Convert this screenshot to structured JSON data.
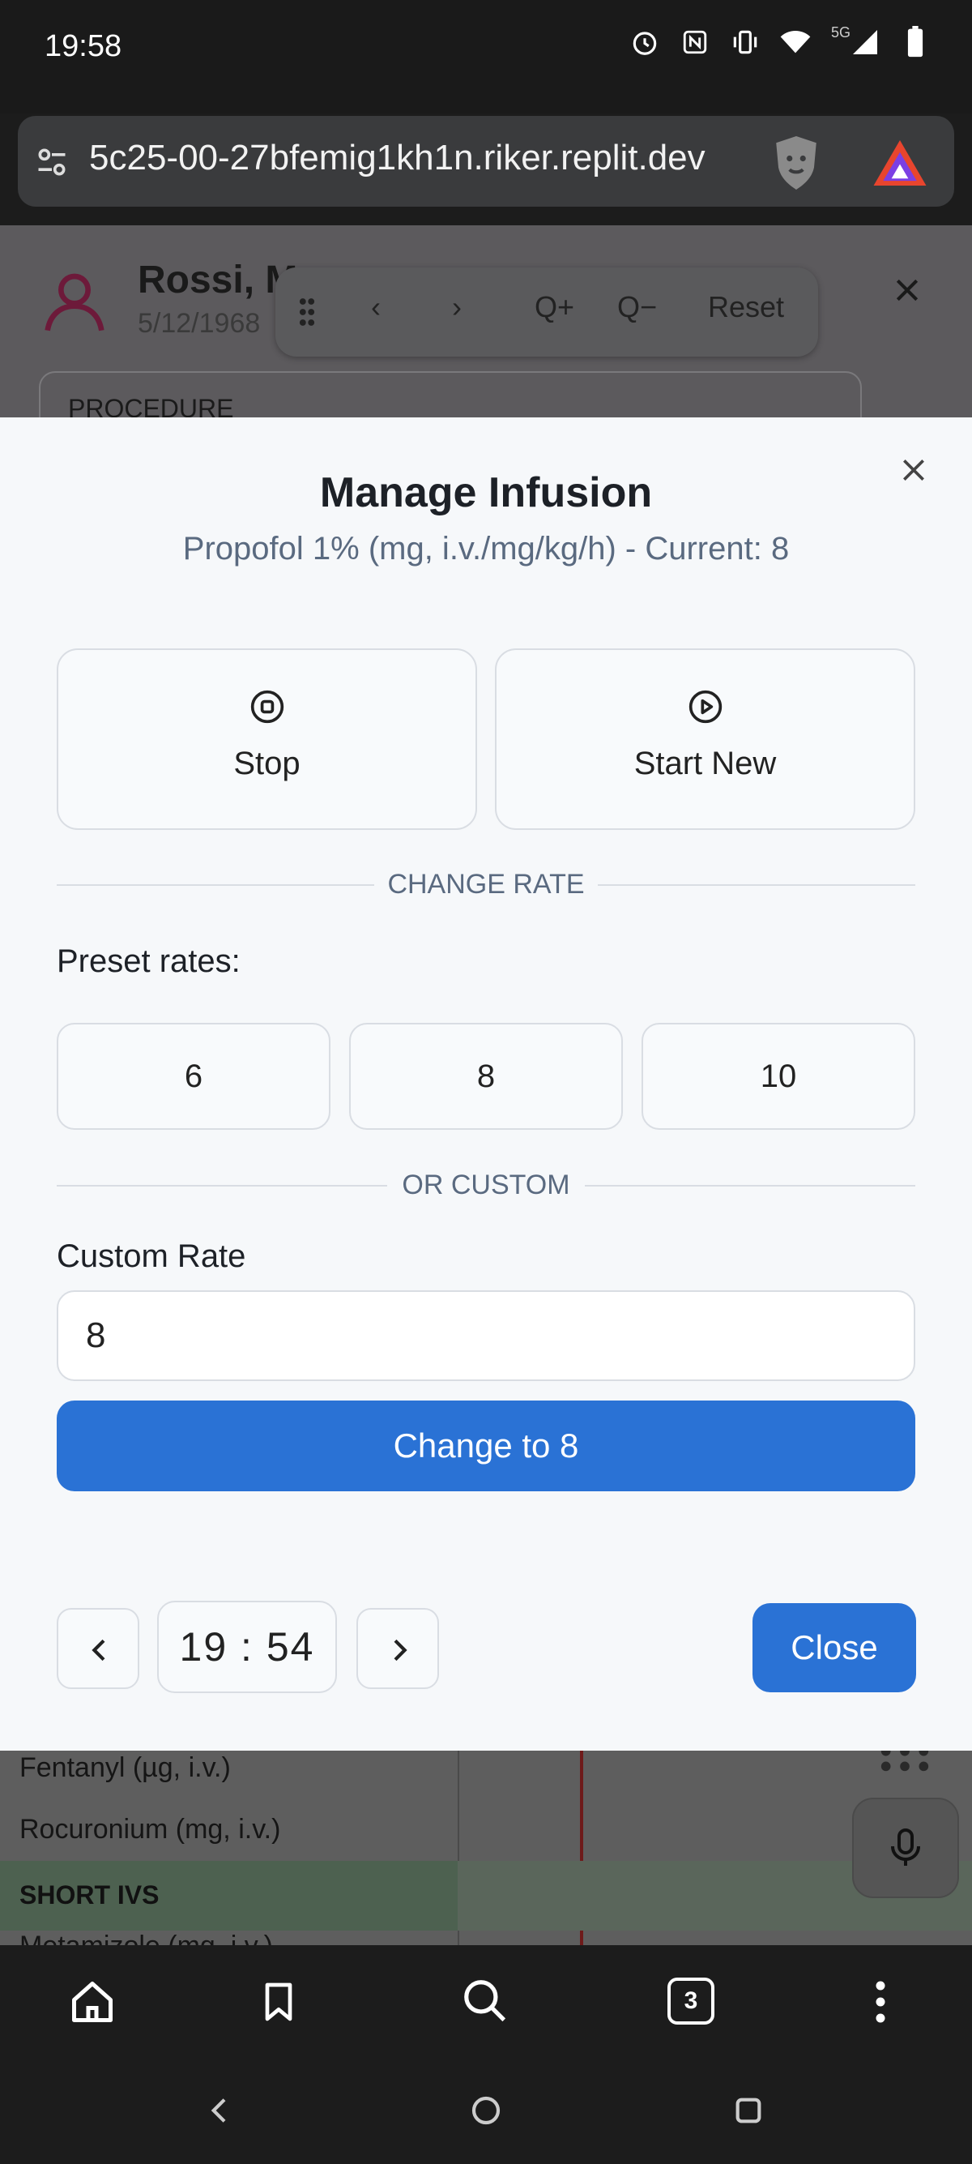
{
  "status_bar": {
    "time": "19:58",
    "network": "5G"
  },
  "browser": {
    "url": "5c25-00-27bfemig1kh1n.riker.replit.dev",
    "tab_count": "3"
  },
  "background": {
    "patient_name": "Rossi, M",
    "patient_dob": "5/12/1968",
    "procedure_label": "PROCEDURE",
    "zoom_toolbar": {
      "prev": "‹",
      "next": "›",
      "zoom_in": "Q+",
      "zoom_out": "Q−",
      "reset": "Reset"
    },
    "rows": [
      "Fentanyl (µg, i.v.)",
      "Rocuronium (mg, i.v.)"
    ],
    "section_label": "SHORT IVS",
    "last_row": "Metamizole (mg, i.v.)"
  },
  "dialog": {
    "title": "Manage Infusion",
    "subtitle": "Propofol 1% (mg, i.v./mg/kg/h) - Current: 8",
    "stop_label": "Stop",
    "start_new_label": "Start New",
    "change_rate_divider": "CHANGE RATE",
    "preset_label": "Preset rates:",
    "presets": [
      "6",
      "8",
      "10"
    ],
    "or_custom_divider": "OR CUSTOM",
    "custom_rate_label": "Custom Rate",
    "custom_rate_value": "8",
    "change_button": "Change to 8",
    "time_value": "19 : 54",
    "close_button": "Close"
  },
  "colors": {
    "accent": "#2a72d5",
    "dialog_bg": "#f6f8fa",
    "border": "#d9dde3"
  }
}
